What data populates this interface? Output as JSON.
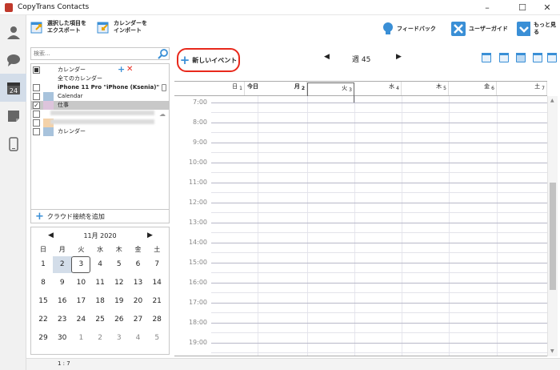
{
  "window": {
    "title": "CopyTrans Contacts",
    "minimize": "–",
    "maximize": "☐",
    "close": "✕"
  },
  "sidebar": {
    "items": [
      {
        "icon": "person-icon"
      },
      {
        "icon": "chat-icon"
      },
      {
        "icon": "calendar-icon",
        "badge": "24",
        "active": true
      },
      {
        "icon": "notes-icon"
      },
      {
        "icon": "phone-icon"
      }
    ]
  },
  "toolbar": {
    "export_label": "選択した項目を\nエクスポート",
    "import_label": "カレンダーを\nインポート",
    "feedback_label": "フィードバック",
    "guide_label": "ユーザーガイド",
    "more_label": "もっと見る"
  },
  "search": {
    "placeholder": "検索..."
  },
  "calendars": [
    {
      "label": "カレンダー",
      "checkbox": "partial",
      "swatch": "",
      "indent": 0
    },
    {
      "label": "全てのカレンダー",
      "checkbox": "none",
      "swatch": "",
      "indent": 0
    },
    {
      "label": "iPhone 11 Pro \"iPhone (Ksenia)\"",
      "checkbox": "unchecked",
      "swatch": "",
      "bold": true
    },
    {
      "label": "Calendar",
      "checkbox": "unchecked",
      "swatch": "#a8c3dc"
    },
    {
      "label": "仕事",
      "checkbox": "checked",
      "swatch": "#ddc4dc",
      "selected": true
    },
    {
      "label": "",
      "checkbox": "unchecked",
      "swatch": "",
      "blurred": true
    },
    {
      "label": "",
      "checkbox": "unchecked",
      "swatch": "#f4d2a9",
      "blurred": true
    },
    {
      "label": "カレンダー",
      "checkbox": "unchecked",
      "swatch": "#a8c3dc"
    }
  ],
  "cloud": {
    "label": "クラウド接続を追加"
  },
  "minical": {
    "month": "11月 2020",
    "weekdays": [
      "日",
      "月",
      "火",
      "水",
      "木",
      "金",
      "土"
    ],
    "weeks": [
      [
        "1",
        "2",
        "3",
        "4",
        "5",
        "6",
        "7"
      ],
      [
        "8",
        "9",
        "10",
        "11",
        "12",
        "13",
        "14"
      ],
      [
        "15",
        "16",
        "17",
        "18",
        "19",
        "20",
        "21"
      ],
      [
        "22",
        "23",
        "24",
        "25",
        "26",
        "27",
        "28"
      ],
      [
        "29",
        "30",
        "1",
        "2",
        "3",
        "4",
        "5"
      ]
    ],
    "today": "3",
    "selected": "2"
  },
  "newevent": {
    "label": "新しいイベント"
  },
  "weeknav": {
    "label": "週 45"
  },
  "days": [
    {
      "label": "日",
      "num": "1"
    },
    {
      "label": "今日",
      "num": "",
      "today_label": true
    },
    {
      "label": "月",
      "num": "2",
      "bold": true
    },
    {
      "label": "火",
      "num": "3",
      "outlined": true
    },
    {
      "label": "水",
      "num": "4"
    },
    {
      "label": "木",
      "num": "5"
    },
    {
      "label": "金",
      "num": "6"
    },
    {
      "label": "土",
      "num": "7"
    }
  ],
  "times": [
    "7:00",
    "8:00",
    "9:00",
    "10:00",
    "11:00",
    "12:00",
    "13:00",
    "14:00",
    "15:00",
    "16:00",
    "17:00",
    "18:00",
    "19:00"
  ],
  "status": {
    "zoom": "1 : 7"
  },
  "colors": {
    "accent": "#3a8fd6",
    "highlight": "#e8281b",
    "selected_row": "#c8c8c8"
  }
}
